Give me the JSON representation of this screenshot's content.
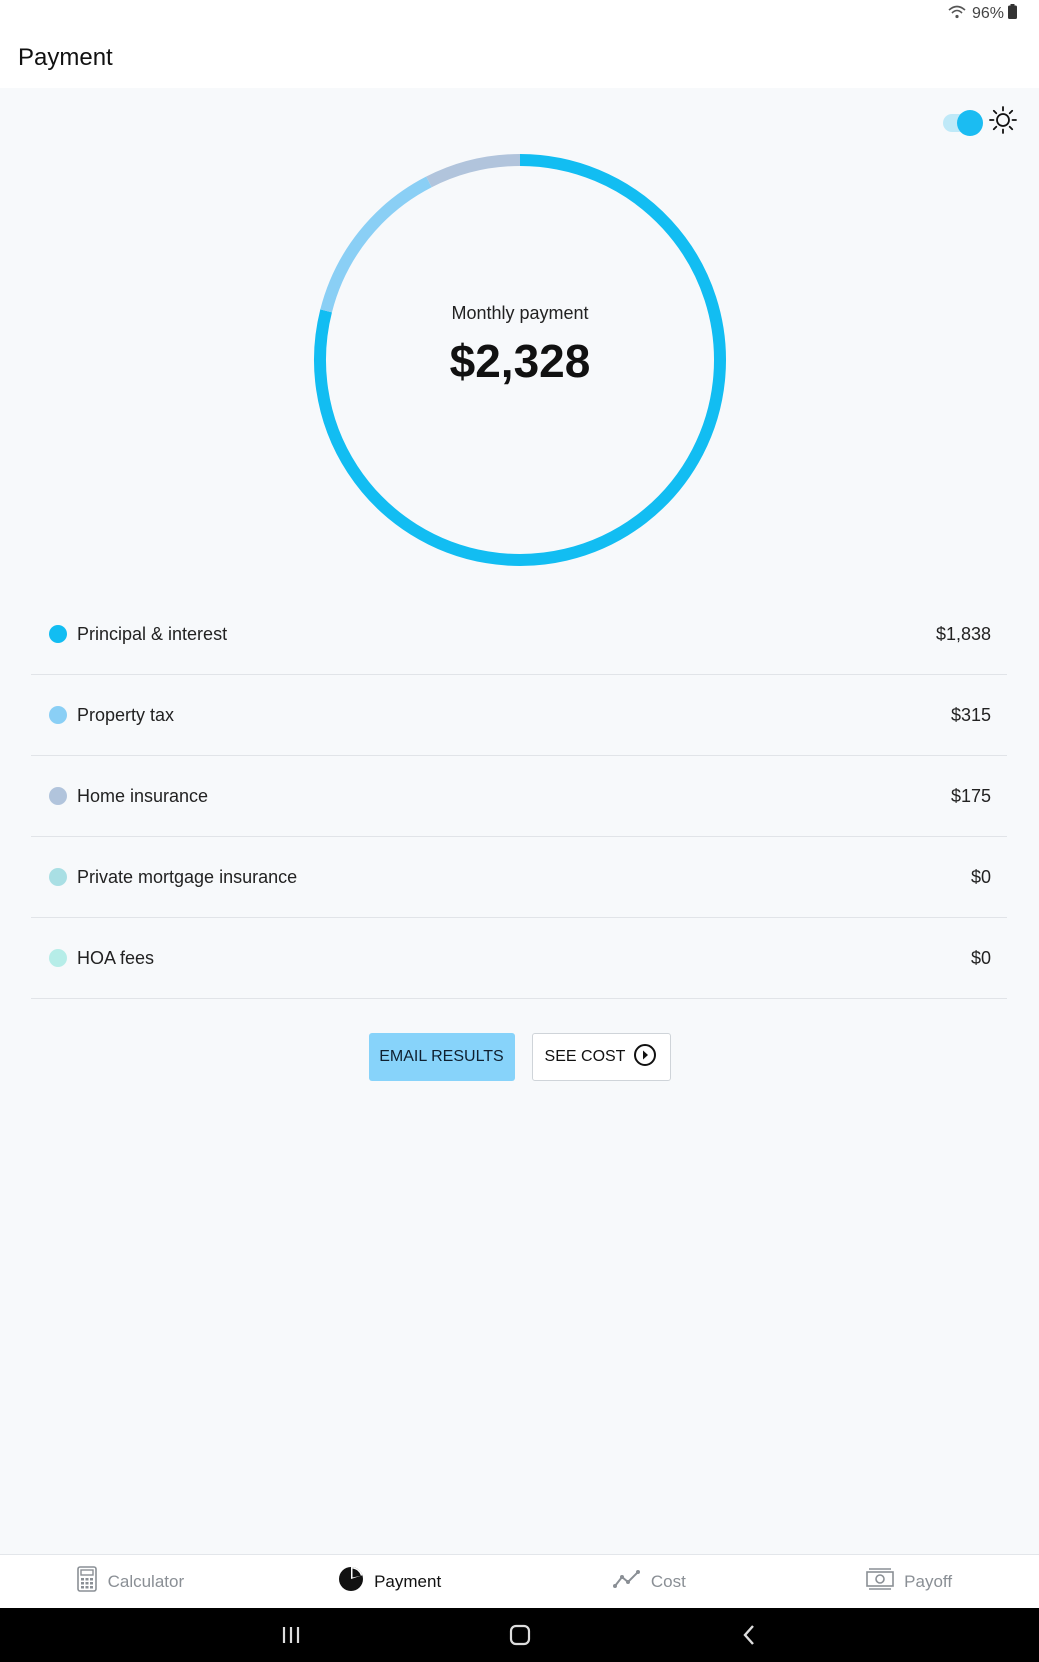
{
  "status_bar": {
    "battery": "96%"
  },
  "header": {
    "title": "Payment"
  },
  "theme": {
    "toggle_on": true,
    "icon": "sun-icon"
  },
  "summary": {
    "label": "Monthly payment",
    "amount": "$2,328"
  },
  "chart_data": {
    "type": "pie",
    "categories": [
      "Principal & interest",
      "Property tax",
      "Home insurance",
      "Private mortgage insurance",
      "HOA fees"
    ],
    "values": [
      1838,
      315,
      175,
      0,
      0
    ],
    "colors": [
      "#12bdf2",
      "#8acff5",
      "#b1c4dc",
      "#a9dfe4",
      "#b6ede8"
    ]
  },
  "breakdown": [
    {
      "label": "Principal & interest",
      "value": "$1,838",
      "color": "#12bdf2"
    },
    {
      "label": "Property tax",
      "value": "$315",
      "color": "#8acff5"
    },
    {
      "label": "Home insurance",
      "value": "$175",
      "color": "#b1c4dc"
    },
    {
      "label": "Private mortgage insurance",
      "value": "$0",
      "color": "#a9dfe4"
    },
    {
      "label": "HOA fees",
      "value": "$0",
      "color": "#b6ede8"
    }
  ],
  "actions": {
    "email_label": "EMAIL RESULTS",
    "cost_label": "SEE COST"
  },
  "nav": {
    "items": [
      {
        "label": "Calculator",
        "icon": "calculator-icon"
      },
      {
        "label": "Payment",
        "icon": "pie-chart-icon",
        "active": true
      },
      {
        "label": "Cost",
        "icon": "line-chart-icon"
      },
      {
        "label": "Payoff",
        "icon": "money-icon"
      }
    ]
  }
}
